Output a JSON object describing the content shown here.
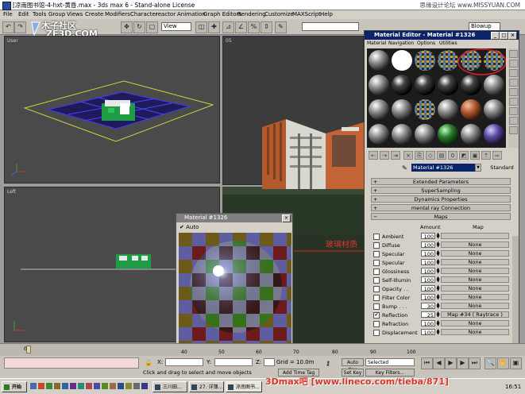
{
  "titlebar": {
    "title": "[凉南图书馆-4-hxt-黄昏.max - 3ds max 6 - Stand-alone License",
    "watermark": "思缘设计论坛 www.MISSYUAN.COM"
  },
  "menu": [
    "File",
    "Edit",
    "Tools",
    "Group",
    "Views",
    "Create",
    "Modifiers",
    "Character",
    "reactor",
    "Animation",
    "Graph Editors",
    "Rendering",
    "Customize",
    "MAXScript",
    "Help"
  ],
  "toolbar": {
    "view_select": "View",
    "named_sel": "Blowup"
  },
  "logo": {
    "line1": "木子社区",
    "line2": "ZF3D.COM"
  },
  "viewports": {
    "top_left": "User",
    "top_right": "05",
    "bottom_left": "Left"
  },
  "mated": {
    "title": "Material Editor - Material #1326",
    "menu": [
      "Material",
      "Navigation",
      "Options",
      "Utilities"
    ],
    "material_name": "Material #1326",
    "type_btn": "Standard",
    "rollouts": [
      "Extended Parameters",
      "SuperSampling",
      "Dynamics Properties",
      "mental ray Connection",
      "Maps"
    ],
    "map_headers": {
      "amount": "Amount",
      "map": "Map"
    },
    "maps": [
      {
        "name": "Ambient",
        "amount": "100",
        "map": "",
        "checked": false
      },
      {
        "name": "Diffuse",
        "amount": "100",
        "map": "None",
        "checked": false
      },
      {
        "name": "Specular",
        "amount": "100",
        "map": "None",
        "checked": false
      },
      {
        "name": "Specular",
        "amount": "100",
        "map": "None",
        "checked": false
      },
      {
        "name": "Glossiness",
        "amount": "100",
        "map": "None",
        "checked": false
      },
      {
        "name": "Self-Illumin",
        "amount": "100",
        "map": "None",
        "checked": false
      },
      {
        "name": "Opacity . .",
        "amount": "100",
        "map": "None",
        "checked": false
      },
      {
        "name": "Filter Color",
        "amount": "100",
        "map": "None",
        "checked": false
      },
      {
        "name": "Bump . . .",
        "amount": "30",
        "map": "None",
        "checked": false
      },
      {
        "name": "Reflection",
        "amount": "25",
        "map": "Map #34  ( Raytrace )",
        "checked": true
      },
      {
        "name": "Refraction",
        "amount": "100",
        "map": "None",
        "checked": false
      },
      {
        "name": "Displacement",
        "amount": "100",
        "map": "None",
        "checked": false
      }
    ]
  },
  "matprev": {
    "title": "Material #1326",
    "auto": "Auto"
  },
  "annotation": "玻璃材质",
  "timeline": {
    "ticks": [
      "40",
      "50",
      "60",
      "70",
      "80",
      "90",
      "100"
    ],
    "frame": "0"
  },
  "status": {
    "x_label": "X:",
    "y_label": "Y:",
    "z_label": "Z:",
    "grid": "Grid = 10.0m",
    "prompt": "Click and drag to select and move objects",
    "add_time_tag": "Add Time Tag",
    "auto_key": "Auto Key",
    "selected": "Selected",
    "set_key": "Set Key",
    "key_filters": "Key Filters..."
  },
  "taskbar": {
    "start": "开始",
    "items": [
      "三川田...",
      "27. 详簿...",
      "凉南图书..."
    ],
    "clock": "16:51"
  },
  "bottom_watermark": "3Dmax吧 [www.lineco.com/tieba/871]",
  "colors": {
    "titlebar_active": "#0a246a",
    "annotation": "#d8362a",
    "circle": "#e02020"
  }
}
